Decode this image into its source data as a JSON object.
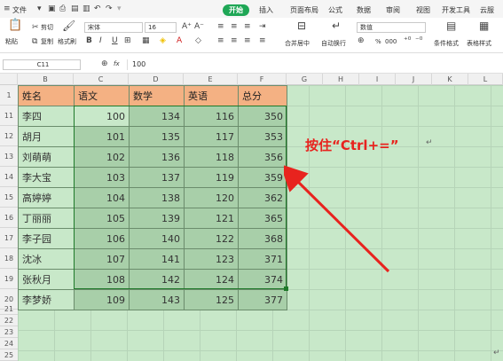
{
  "menu": {
    "file": "文件",
    "tabs": [
      "开始",
      "插入",
      "页面布局",
      "公式",
      "数据",
      "审阅",
      "视图",
      "开发工具",
      "云服"
    ],
    "active_tab": "开始"
  },
  "ribbon": {
    "paste": "粘贴",
    "cut": "剪切",
    "copy": "复制",
    "format_painter": "格式刷",
    "font_name": "宋体",
    "font_size": "16",
    "bold": "B",
    "italic": "I",
    "underline": "U",
    "merge_center": "合并居中",
    "wrap_text": "自动换行",
    "number_format": "数值",
    "percent": "%",
    "thousands": "000",
    "cond_format": "条件格式",
    "table_style": "表格样式"
  },
  "formula_bar": {
    "name_box": "C11",
    "fx": "fx",
    "value": "100"
  },
  "columns": [
    "B",
    "C",
    "D",
    "E",
    "F",
    "G",
    "H",
    "I",
    "J",
    "K",
    "L"
  ],
  "rows": [
    "1",
    "11",
    "12",
    "13",
    "14",
    "15",
    "16",
    "17",
    "18",
    "19",
    "20",
    "21",
    "22",
    "23",
    "24",
    "25"
  ],
  "table": {
    "headers": [
      "姓名",
      "语文",
      "数学",
      "英语",
      "总分"
    ],
    "rows": [
      [
        "李四",
        "100",
        "134",
        "116",
        "350"
      ],
      [
        "胡月",
        "101",
        "135",
        "117",
        "353"
      ],
      [
        "刘萌萌",
        "102",
        "136",
        "118",
        "356"
      ],
      [
        "李大宝",
        "103",
        "137",
        "119",
        "359"
      ],
      [
        "高婷婷",
        "104",
        "138",
        "120",
        "362"
      ],
      [
        "丁丽丽",
        "105",
        "139",
        "121",
        "365"
      ],
      [
        "李子园",
        "106",
        "140",
        "122",
        "368"
      ],
      [
        "沈冰",
        "107",
        "141",
        "123",
        "371"
      ],
      [
        "张秋月",
        "108",
        "142",
        "124",
        "374"
      ],
      [
        "李梦娇",
        "109",
        "143",
        "125",
        "377"
      ]
    ]
  },
  "annotation": "按住“Ctrl+=”",
  "colors": {
    "header_fill": "#f4b183",
    "selection_fill": "#a8cfa9",
    "sheet_green": "#c8e8c9",
    "annotation": "#e8231e",
    "active_tab": "#1fa756"
  }
}
